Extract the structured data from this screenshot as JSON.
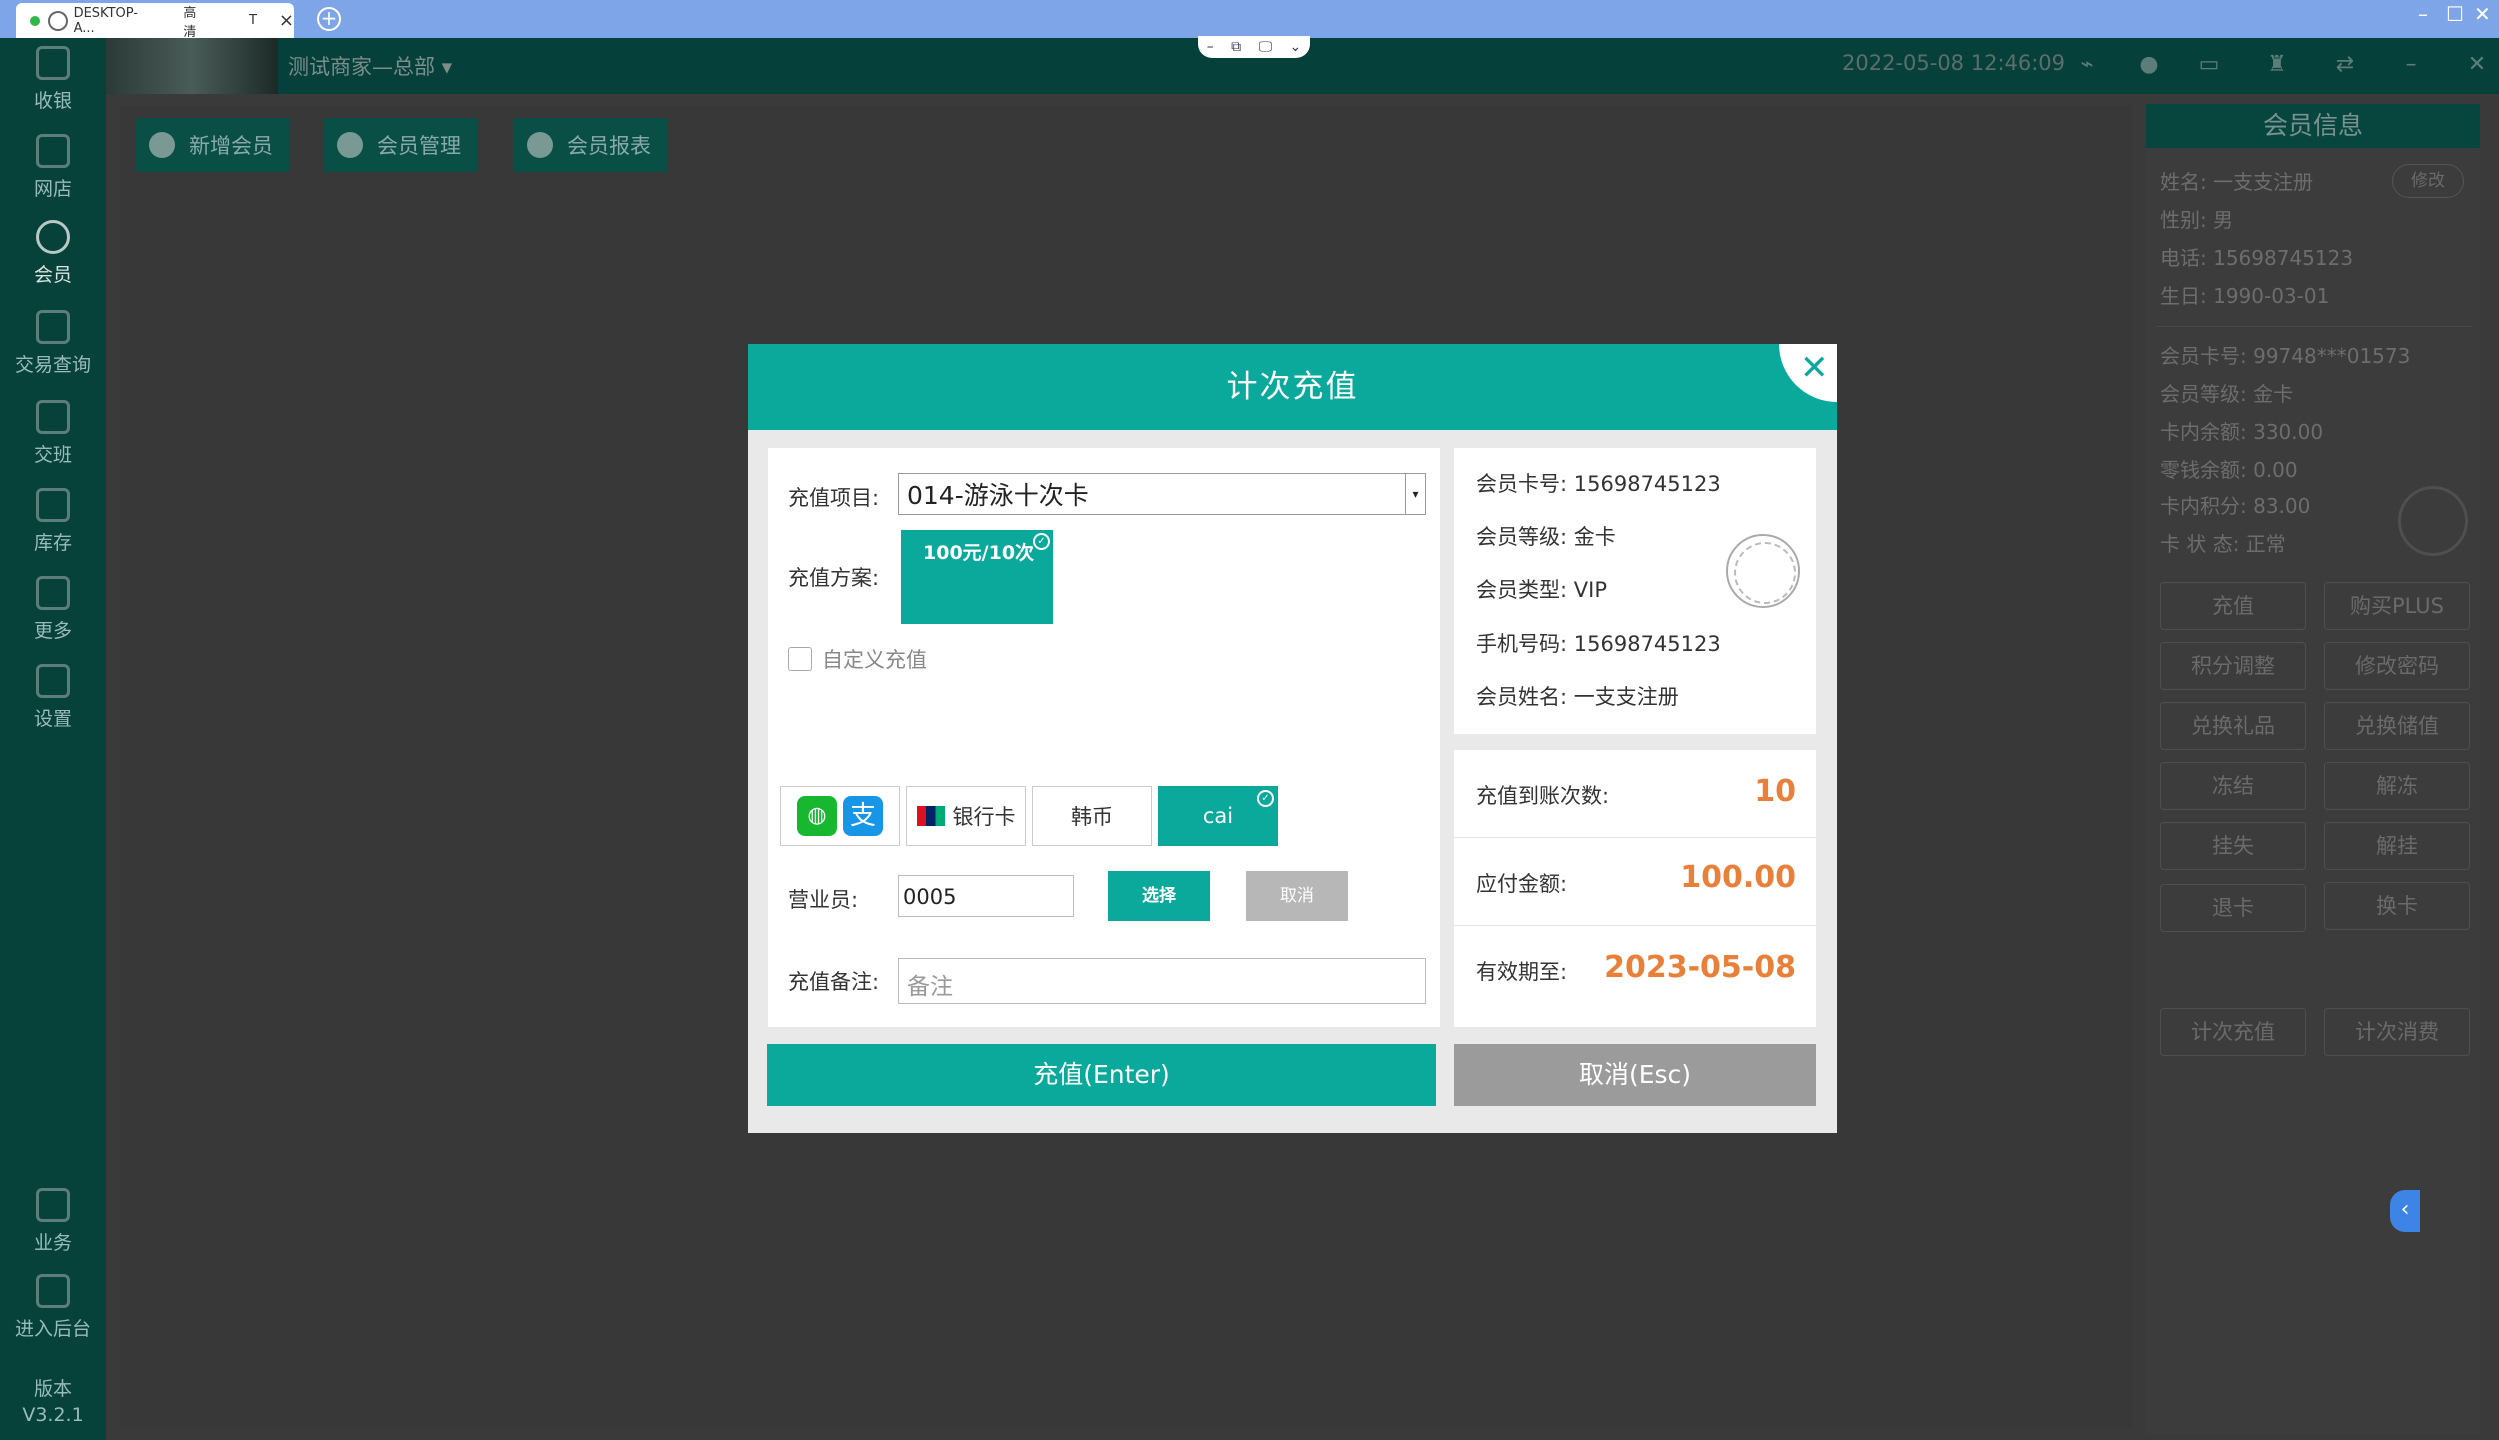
{
  "remote": {
    "tab_title": "DESKTOP-A...",
    "tab_quality": "高清",
    "tab_t": "T",
    "tab_close": "×",
    "add_tab": "+",
    "win_min": "–",
    "win_max": "☐",
    "win_close": "✕",
    "center_controls": [
      "–",
      "⧉",
      "🖵",
      "⌄"
    ]
  },
  "sidebar": {
    "items": [
      {
        "label": "收银",
        "icon": "cashier-icon"
      },
      {
        "label": "网店",
        "icon": "shop-icon"
      },
      {
        "label": "会员",
        "icon": "member-icon"
      },
      {
        "label": "交易查询",
        "icon": "transaction-icon"
      },
      {
        "label": "交班",
        "icon": "shift-icon"
      },
      {
        "label": "库存",
        "icon": "inventory-icon"
      },
      {
        "label": "更多",
        "icon": "more-icon"
      },
      {
        "label": "设置",
        "icon": "settings-icon"
      },
      {
        "label": "业务",
        "icon": "business-icon"
      },
      {
        "label": "进入后台",
        "icon": "backend-icon"
      }
    ],
    "version_label": "版本",
    "version": "V3.2.1"
  },
  "topbar": {
    "store": "测试商家—总部",
    "datetime": "2022-05-08 12:46:09"
  },
  "actions": [
    {
      "label": "新增会员"
    },
    {
      "label": "会员管理"
    },
    {
      "label": "会员报表"
    }
  ],
  "member_panel": {
    "title": "会员信息",
    "edit": "修改",
    "lines": [
      "姓名:  一支支注册",
      "性别:  男",
      "电话:  15698745123",
      "生日:  1990-03-01",
      "会员卡号:  99748***01573",
      "会员等级:  金卡",
      "卡内余额:  330.00",
      "零钱余额:  0.00",
      "卡内积分:  83.00",
      "卡 状 态:  正常"
    ],
    "buttons": [
      "充值",
      "购买PLUS",
      "积分调整",
      "修改密码",
      "兑换礼品",
      "兑换储值",
      "冻结",
      "解冻",
      "挂失",
      "解挂",
      "退卡",
      "换卡"
    ],
    "bottom_buttons": [
      "计次充值",
      "计次消费"
    ]
  },
  "modal": {
    "title": "计次充值",
    "labels": {
      "project": "充值项目:",
      "plan": "充值方案:",
      "custom": "自定义充值",
      "staff": "营业员:",
      "remark": "充值备注:"
    },
    "project_value": "014-游泳十次卡",
    "plan_option": "100元/10次",
    "payments": {
      "bankcard": "银行卡",
      "korean": "韩币",
      "cai": "cai"
    },
    "staff_value": "0005",
    "select_btn": "选择",
    "cancel_small": "取消",
    "remark_placeholder": "备注",
    "info": [
      {
        "label": "会员卡号:",
        "value": "15698745123"
      },
      {
        "label": "会员等级:",
        "value": "金卡"
      },
      {
        "label": "会员类型:",
        "value": "VIP"
      },
      {
        "label": "手机号码:",
        "value": "15698745123"
      },
      {
        "label": "会员姓名:",
        "value": "一支支注册"
      }
    ],
    "summary": [
      {
        "label": "充值到账次数:",
        "value": "10"
      },
      {
        "label": "应付金额:",
        "value": "100.00"
      },
      {
        "label": "有效期至:",
        "value": "2023-05-08"
      }
    ],
    "confirm": "充值(Enter)",
    "cancel": "取消(Esc)"
  }
}
